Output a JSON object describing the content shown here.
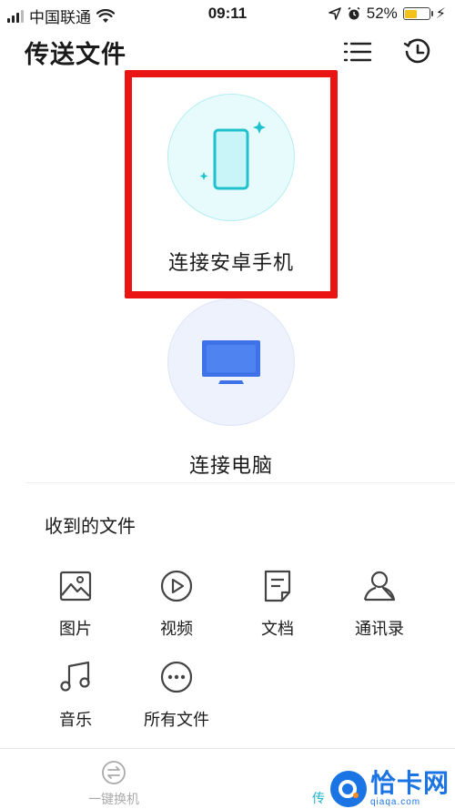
{
  "status_bar": {
    "carrier": "中国联通",
    "time": "09:11",
    "battery_percent": "52%",
    "battery_level": 0.52,
    "battery_color": "#f2c21b"
  },
  "header": {
    "title": "传送文件",
    "icons": [
      "list-icon",
      "history-clock-icon"
    ]
  },
  "connect": {
    "android_label": "连接安卓手机",
    "pc_label": "连接电脑",
    "android_color": "#1fc2cc",
    "pc_color": "#3d72e8",
    "highlight_color": "#ea1414"
  },
  "received": {
    "title": "收到的文件",
    "items": [
      {
        "label": "图片",
        "icon": "image-icon"
      },
      {
        "label": "视频",
        "icon": "video-play-icon"
      },
      {
        "label": "文档",
        "icon": "document-icon"
      },
      {
        "label": "通讯录",
        "icon": "contacts-icon"
      },
      {
        "label": "音乐",
        "icon": "music-note-icon"
      },
      {
        "label": "所有文件",
        "icon": "more-dots-icon"
      }
    ]
  },
  "bottom_bar": {
    "tab_switch_label": "一键换机",
    "tab_transfer_label": "传",
    "watermark_cn": "恰卡网",
    "watermark_en": "qiaqa.com"
  }
}
